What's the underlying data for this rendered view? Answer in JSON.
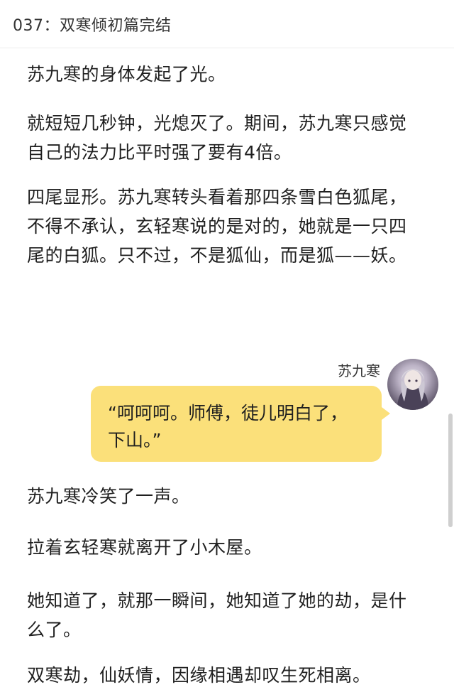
{
  "header": {
    "chapter_title": "037：双寒倾初篇完结"
  },
  "content": {
    "p1": "苏九寒的身体发起了光。",
    "p2": "就短短几秒钟，光熄灭了。期间，苏九寒只感觉自己的法力比平时强了要有4倍。",
    "p3": "四尾显形。苏九寒转头看着那四条雪白色狐尾，不得不承认，玄轻寒说的是对的，她就是一只四尾的白狐。只不过，不是狐仙，而是狐——妖。",
    "p4": "苏九寒冷笑了一声。",
    "p5": "拉着玄轻寒就离开了小木屋。",
    "p6": "她知道了，就那一瞬间，她知道了她的劫，是什么了。",
    "p7": "双寒劫，仙妖情，因缘相遇却叹生死相离。"
  },
  "dialogue": {
    "speaker": "苏九寒",
    "text": "“呵呵呵。师傅，徒儿明白了，下山。”"
  },
  "colors": {
    "bubble": "#fbe07a",
    "text": "#1f1f1f"
  },
  "icons": {
    "avatar": "character-avatar-icon"
  }
}
